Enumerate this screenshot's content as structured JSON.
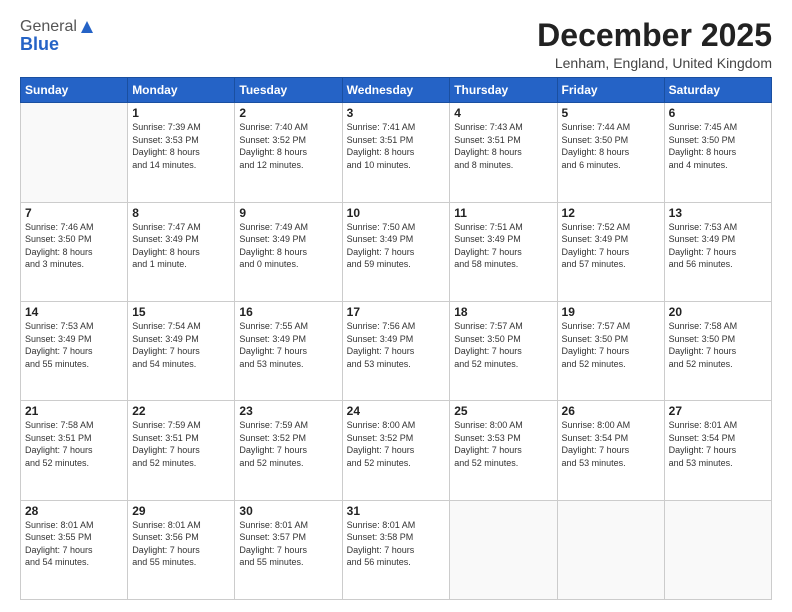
{
  "logo": {
    "general": "General",
    "blue": "Blue"
  },
  "header": {
    "month_year": "December 2025",
    "location": "Lenham, England, United Kingdom"
  },
  "days": [
    "Sunday",
    "Monday",
    "Tuesday",
    "Wednesday",
    "Thursday",
    "Friday",
    "Saturday"
  ],
  "weeks": [
    [
      {
        "day": "",
        "content": ""
      },
      {
        "day": "1",
        "content": "Sunrise: 7:39 AM\nSunset: 3:53 PM\nDaylight: 8 hours\nand 14 minutes."
      },
      {
        "day": "2",
        "content": "Sunrise: 7:40 AM\nSunset: 3:52 PM\nDaylight: 8 hours\nand 12 minutes."
      },
      {
        "day": "3",
        "content": "Sunrise: 7:41 AM\nSunset: 3:51 PM\nDaylight: 8 hours\nand 10 minutes."
      },
      {
        "day": "4",
        "content": "Sunrise: 7:43 AM\nSunset: 3:51 PM\nDaylight: 8 hours\nand 8 minutes."
      },
      {
        "day": "5",
        "content": "Sunrise: 7:44 AM\nSunset: 3:50 PM\nDaylight: 8 hours\nand 6 minutes."
      },
      {
        "day": "6",
        "content": "Sunrise: 7:45 AM\nSunset: 3:50 PM\nDaylight: 8 hours\nand 4 minutes."
      }
    ],
    [
      {
        "day": "7",
        "content": "Sunrise: 7:46 AM\nSunset: 3:50 PM\nDaylight: 8 hours\nand 3 minutes."
      },
      {
        "day": "8",
        "content": "Sunrise: 7:47 AM\nSunset: 3:49 PM\nDaylight: 8 hours\nand 1 minute."
      },
      {
        "day": "9",
        "content": "Sunrise: 7:49 AM\nSunset: 3:49 PM\nDaylight: 8 hours\nand 0 minutes."
      },
      {
        "day": "10",
        "content": "Sunrise: 7:50 AM\nSunset: 3:49 PM\nDaylight: 7 hours\nand 59 minutes."
      },
      {
        "day": "11",
        "content": "Sunrise: 7:51 AM\nSunset: 3:49 PM\nDaylight: 7 hours\nand 58 minutes."
      },
      {
        "day": "12",
        "content": "Sunrise: 7:52 AM\nSunset: 3:49 PM\nDaylight: 7 hours\nand 57 minutes."
      },
      {
        "day": "13",
        "content": "Sunrise: 7:53 AM\nSunset: 3:49 PM\nDaylight: 7 hours\nand 56 minutes."
      }
    ],
    [
      {
        "day": "14",
        "content": "Sunrise: 7:53 AM\nSunset: 3:49 PM\nDaylight: 7 hours\nand 55 minutes."
      },
      {
        "day": "15",
        "content": "Sunrise: 7:54 AM\nSunset: 3:49 PM\nDaylight: 7 hours\nand 54 minutes."
      },
      {
        "day": "16",
        "content": "Sunrise: 7:55 AM\nSunset: 3:49 PM\nDaylight: 7 hours\nand 53 minutes."
      },
      {
        "day": "17",
        "content": "Sunrise: 7:56 AM\nSunset: 3:49 PM\nDaylight: 7 hours\nand 53 minutes."
      },
      {
        "day": "18",
        "content": "Sunrise: 7:57 AM\nSunset: 3:50 PM\nDaylight: 7 hours\nand 52 minutes."
      },
      {
        "day": "19",
        "content": "Sunrise: 7:57 AM\nSunset: 3:50 PM\nDaylight: 7 hours\nand 52 minutes."
      },
      {
        "day": "20",
        "content": "Sunrise: 7:58 AM\nSunset: 3:50 PM\nDaylight: 7 hours\nand 52 minutes."
      }
    ],
    [
      {
        "day": "21",
        "content": "Sunrise: 7:58 AM\nSunset: 3:51 PM\nDaylight: 7 hours\nand 52 minutes."
      },
      {
        "day": "22",
        "content": "Sunrise: 7:59 AM\nSunset: 3:51 PM\nDaylight: 7 hours\nand 52 minutes."
      },
      {
        "day": "23",
        "content": "Sunrise: 7:59 AM\nSunset: 3:52 PM\nDaylight: 7 hours\nand 52 minutes."
      },
      {
        "day": "24",
        "content": "Sunrise: 8:00 AM\nSunset: 3:52 PM\nDaylight: 7 hours\nand 52 minutes."
      },
      {
        "day": "25",
        "content": "Sunrise: 8:00 AM\nSunset: 3:53 PM\nDaylight: 7 hours\nand 52 minutes."
      },
      {
        "day": "26",
        "content": "Sunrise: 8:00 AM\nSunset: 3:54 PM\nDaylight: 7 hours\nand 53 minutes."
      },
      {
        "day": "27",
        "content": "Sunrise: 8:01 AM\nSunset: 3:54 PM\nDaylight: 7 hours\nand 53 minutes."
      }
    ],
    [
      {
        "day": "28",
        "content": "Sunrise: 8:01 AM\nSunset: 3:55 PM\nDaylight: 7 hours\nand 54 minutes."
      },
      {
        "day": "29",
        "content": "Sunrise: 8:01 AM\nSunset: 3:56 PM\nDaylight: 7 hours\nand 55 minutes."
      },
      {
        "day": "30",
        "content": "Sunrise: 8:01 AM\nSunset: 3:57 PM\nDaylight: 7 hours\nand 55 minutes."
      },
      {
        "day": "31",
        "content": "Sunrise: 8:01 AM\nSunset: 3:58 PM\nDaylight: 7 hours\nand 56 minutes."
      },
      {
        "day": "",
        "content": ""
      },
      {
        "day": "",
        "content": ""
      },
      {
        "day": "",
        "content": ""
      }
    ]
  ]
}
